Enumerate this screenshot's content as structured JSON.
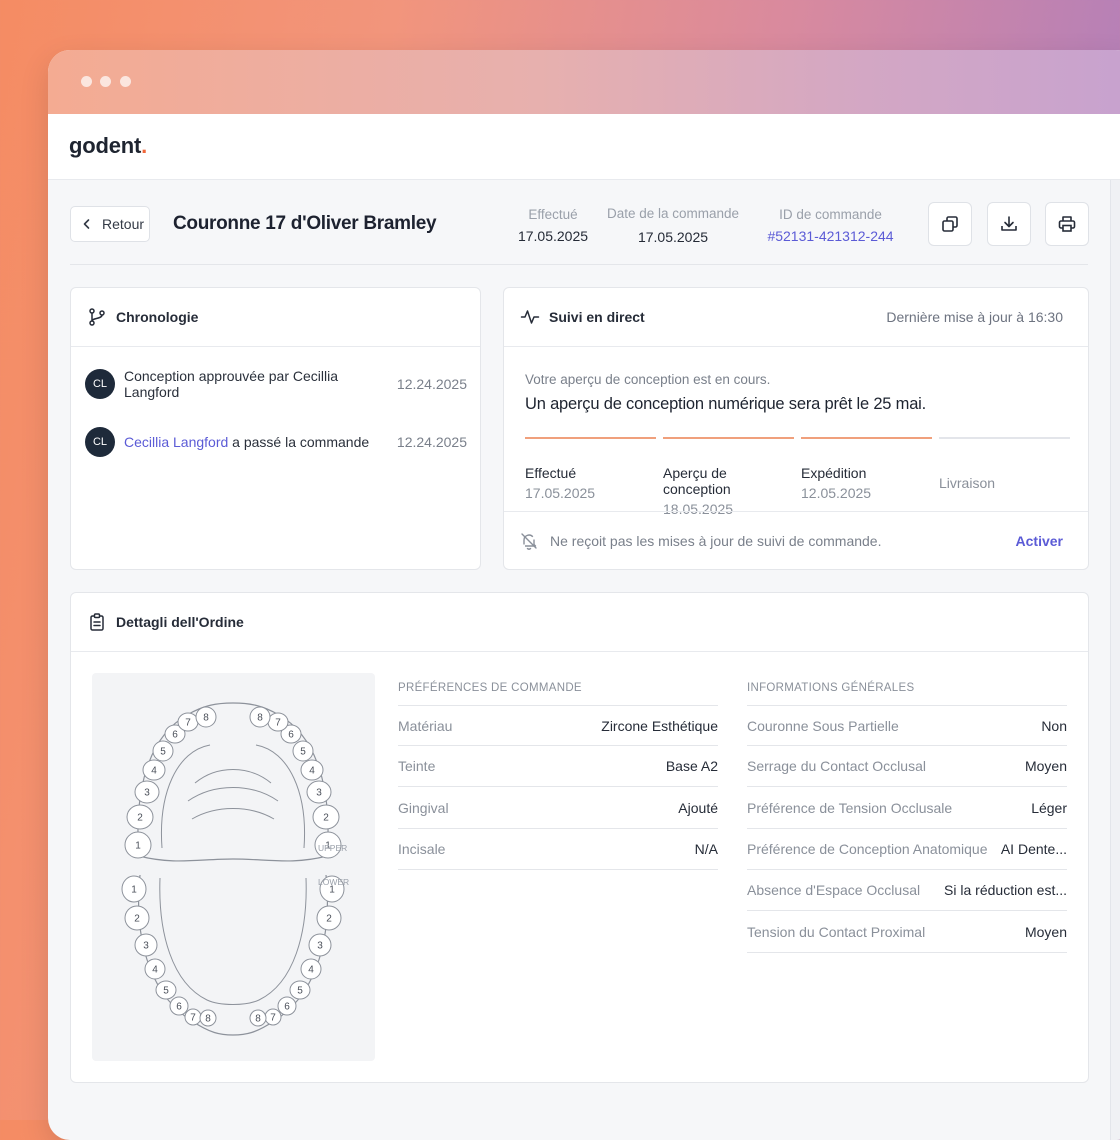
{
  "app": {
    "logo_text": "godent",
    "logo_dot": "."
  },
  "header": {
    "back_label": "Retour",
    "title": "Couronne 17 d'Oliver Bramley",
    "meta": [
      {
        "label": "Effectué",
        "value": "17.05.2025"
      },
      {
        "label": "Date de la commande",
        "value": "17.05.2025"
      },
      {
        "label": "ID de commande",
        "value": "#52131-421312-244"
      }
    ],
    "actions": [
      {
        "icon": "copy-icon"
      },
      {
        "icon": "download-icon"
      },
      {
        "icon": "print-icon"
      }
    ]
  },
  "timeline": {
    "title": "Chronologie",
    "items": [
      {
        "initials": "CL",
        "text": "Conception approuvée par Cecillia Langford",
        "date": "12.24.2025"
      },
      {
        "initials": "CL",
        "link": "Cecillia Langford",
        "text": " a passé la commande",
        "date": "12.24.2025"
      }
    ]
  },
  "tracking": {
    "title": "Suivi en direct",
    "updated": "Dernière mise à jour à 16:30",
    "subtitle": "Votre aperçu de conception est en cours.",
    "message": "Un aperçu de conception numérique sera prêt le 25 mai.",
    "steps": [
      {
        "name": "Effectué",
        "date": "17.05.2025",
        "done": true
      },
      {
        "name": "Aperçu de conception",
        "date": "18.05.2025",
        "done": true
      },
      {
        "name": "Expédition",
        "date": "12.05.2025",
        "done": true
      },
      {
        "name": "Livraison",
        "date": "",
        "done": false
      }
    ],
    "notify_text": "Ne reçoit pas les mises à jour de suivi de commande.",
    "notify_action": "Activer"
  },
  "details": {
    "title": "Dettagli dell'Ordine",
    "chart_labels": {
      "upper": "UPPER",
      "lower": "LOWER"
    },
    "tooth_numbers": [
      "1",
      "2",
      "3",
      "4",
      "5",
      "6",
      "7",
      "8"
    ],
    "preferences": {
      "heading": "PRÉFÉRENCES DE COMMANDE",
      "rows": [
        {
          "k": "Matériau",
          "v": "Zircone Esthétique"
        },
        {
          "k": "Teinte",
          "v": "Base A2"
        },
        {
          "k": "Gingival",
          "v": "Ajouté"
        },
        {
          "k": "Incisale",
          "v": "N/A"
        }
      ]
    },
    "general": {
      "heading": "INFORMATIONS GÉNÉRALES",
      "rows": [
        {
          "k": "Couronne Sous Partielle",
          "v": "Non"
        },
        {
          "k": "Serrage du Contact Occlusal",
          "v": "Moyen"
        },
        {
          "k": "Préférence de Tension Occlusale",
          "v": "Léger"
        },
        {
          "k": "Préférence de Conception Anatomique",
          "v": "AI Dente..."
        },
        {
          "k": "Absence d'Espace Occlusal",
          "v": "Si la réduction est..."
        },
        {
          "k": "Tension du Contact Proximal",
          "v": "Moyen"
        }
      ]
    }
  },
  "colors": {
    "accent": "#5b5bd6",
    "progress": "#f0a07c",
    "logo_dot": "#f0673b"
  }
}
